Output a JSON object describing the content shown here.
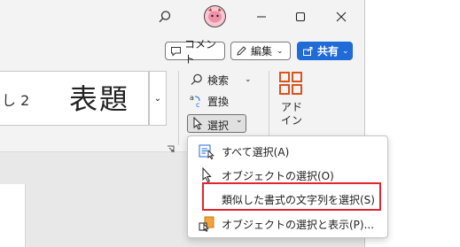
{
  "titlebar": {
    "search_icon": "search-icon",
    "avatar_icon": "avatar-icon",
    "minimize_icon": "minimize-icon",
    "maximize_icon": "maximize-icon",
    "close_icon": "close-icon"
  },
  "actions": {
    "comment_label": "コメント",
    "edit_label": "編集",
    "share_label": "共有"
  },
  "styles_gallery": {
    "heading2_label": "し 2",
    "title_label": "表題"
  },
  "editing_group": {
    "find_label": "検索",
    "replace_label": "置換",
    "select_label": "選択"
  },
  "addins": {
    "label_line1": "アド",
    "label_line2": "イン"
  },
  "select_menu": {
    "items": [
      {
        "label": "すべて選択(A)",
        "icon": "select-all-icon"
      },
      {
        "label": "オブジェクトの選択(O)",
        "icon": "cursor-arrow-icon"
      },
      {
        "label": "類似した書式の文字列を選択(S)",
        "icon": ""
      },
      {
        "label": "オブジェクトの選択と表示(P)...",
        "icon": "selection-pane-icon"
      }
    ]
  },
  "colors": {
    "accent": "#1f6bd8",
    "highlight": "#e0262c",
    "addins_icon": "#d9541e"
  }
}
